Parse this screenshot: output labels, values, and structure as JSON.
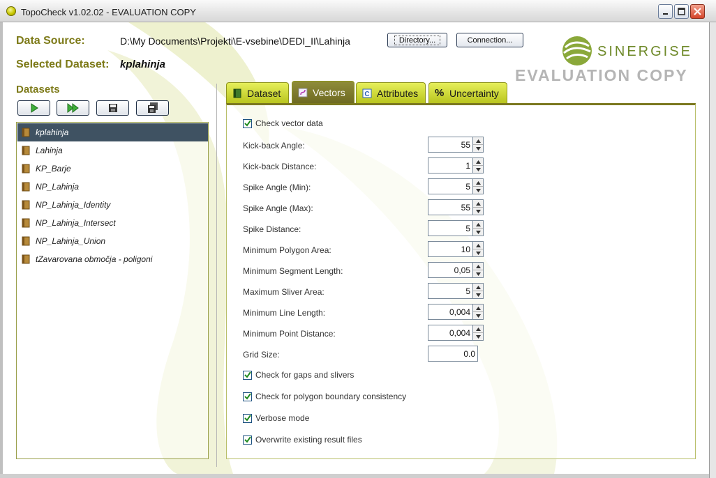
{
  "window": {
    "title": "TopoCheck v1.02.02 - EVALUATION COPY"
  },
  "header": {
    "data_source_label": "Data Source:",
    "data_source_value": "D:\\My Documents\\Projekti\\E-vsebine\\DEDI_II\\Lahinja",
    "directory_button": "Directory...",
    "connection_button": "Connection...",
    "selected_dataset_label": "Selected Dataset:",
    "selected_dataset_value": "kplahinja",
    "logo_text": "SINERGISE",
    "evaluation_text": "EVALUATION COPY"
  },
  "datasets": {
    "label": "Datasets",
    "toolbar_icons": [
      "play-icon",
      "fast-forward-icon",
      "save-icon",
      "save-all-icon"
    ],
    "items": [
      {
        "label": "kplahinja",
        "selected": true
      },
      {
        "label": "Lahinja",
        "selected": false
      },
      {
        "label": "KP_Barje",
        "selected": false
      },
      {
        "label": "NP_Lahinja",
        "selected": false
      },
      {
        "label": "NP_Lahinja_Identity",
        "selected": false
      },
      {
        "label": "NP_Lahinja_Intersect",
        "selected": false
      },
      {
        "label": "NP_Lahinja_Union",
        "selected": false
      },
      {
        "label": "tZavarovana območja - poligoni",
        "selected": false
      }
    ]
  },
  "tabs": [
    {
      "label": "Dataset",
      "icon": "book-icon",
      "active": false
    },
    {
      "label": "Vectors",
      "icon": "vector-icon",
      "active": true
    },
    {
      "label": "Attributes",
      "icon": "attributes-icon",
      "active": false
    },
    {
      "label": "Uncertainty",
      "icon": "percent-icon",
      "active": false
    }
  ],
  "vectors": {
    "check_vector_data": {
      "label": "Check vector data",
      "checked": true
    },
    "fields": [
      {
        "label": "Kick-back Angle:",
        "value": "55"
      },
      {
        "label": "Kick-back Distance:",
        "value": "1"
      },
      {
        "label": "Spike Angle (Min):",
        "value": "5"
      },
      {
        "label": "Spike Angle (Max):",
        "value": "55"
      },
      {
        "label": "Spike Distance:",
        "value": "5"
      },
      {
        "label": "Minimum Polygon Area:",
        "value": "10"
      },
      {
        "label": "Minimum Segment Length:",
        "value": "0,05"
      },
      {
        "label": "Maximum Sliver Area:",
        "value": "5"
      },
      {
        "label": "Minimum Line Length:",
        "value": "0,004"
      },
      {
        "label": "Minimum Point Distance:",
        "value": "0,004"
      }
    ],
    "grid_size": {
      "label": "Grid Size:",
      "value": "0.0"
    },
    "options": [
      {
        "label": "Check for gaps and slivers",
        "checked": true
      },
      {
        "label": "Check for polygon boundary consistency",
        "checked": true
      },
      {
        "label": "Verbose mode",
        "checked": true
      },
      {
        "label": "Overwrite existing result files",
        "checked": true
      }
    ]
  },
  "colors": {
    "accent_olive": "#7d7a18",
    "tab_green": "#c8d42a",
    "tab_active": "#7b781f",
    "selection": "#3f5262"
  }
}
